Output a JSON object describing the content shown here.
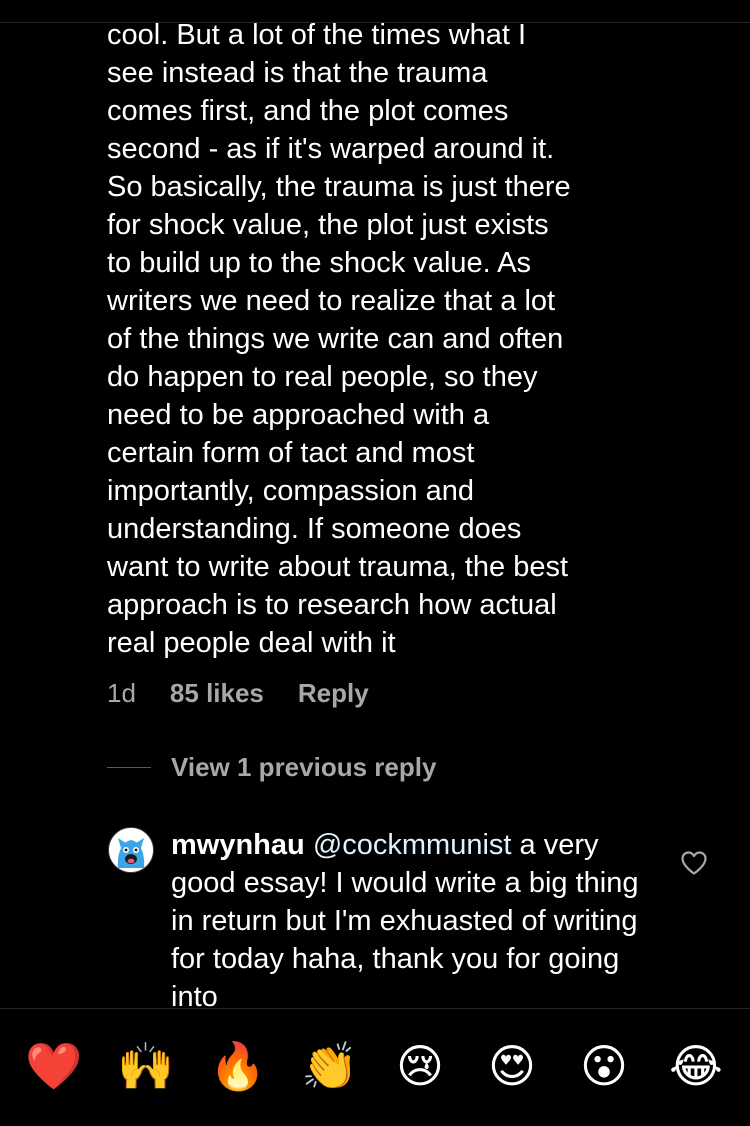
{
  "comment": {
    "text": "cool. But a lot of the times what I\nsee instead is that the trauma\ncomes first, and the plot comes\nsecond - as if it's warped around it.\nSo basically, the trauma is just there\nfor shock value, the plot just exists\nto build up to the shock value.  As\nwriters we need to realize that a lot\nof the things we write can and often\ndo happen to real people, so they\nneed to be approached with a\ncertain form of tact and most\nimportantly, compassion and\nunderstanding. If someone does\nwant to write about trauma, the best\napproach is to research how actual\nreal people deal with it",
    "time": "1d",
    "likes": "85 likes",
    "reply_label": "Reply"
  },
  "replies": {
    "view_label": "View 1 previous reply"
  },
  "reply": {
    "username": "mwynhau",
    "mention": "@cockmmunist",
    "text": " a very good essay! I would write a big thing in return but I'm exhuasted of writing for today haha, thank you for going into"
  },
  "emoji_bar": {
    "items": [
      {
        "name": "red-heart-emoji",
        "glyph": "❤️"
      },
      {
        "name": "raising-hands-emoji",
        "glyph": "🙌"
      },
      {
        "name": "fire-emoji",
        "glyph": "🔥"
      },
      {
        "name": "clapping-hands-emoji",
        "glyph": "👏"
      },
      {
        "name": "crying-face-emoji",
        "glyph": "😢"
      },
      {
        "name": "heart-eyes-emoji",
        "glyph": "😍"
      },
      {
        "name": "surprised-face-emoji",
        "glyph": "😮"
      },
      {
        "name": "tears-of-joy-emoji",
        "glyph": "😂"
      }
    ]
  },
  "colors": {
    "background": "#000000",
    "text": "#ffffff",
    "secondary_text": "#a8a8a8",
    "mention": "#e0f1ff"
  }
}
